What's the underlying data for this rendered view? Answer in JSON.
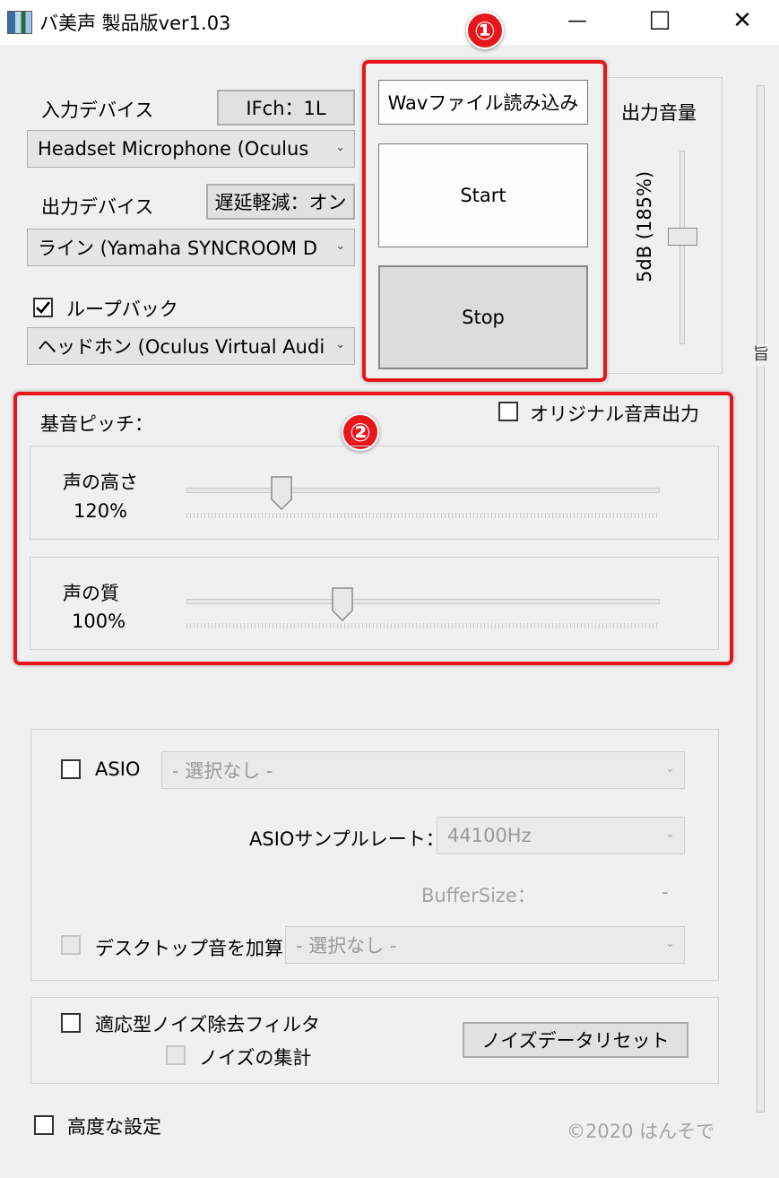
{
  "window": {
    "title": "バ美声 製品版ver1.03",
    "minimize": "—",
    "maximize": "☐",
    "close": "✕"
  },
  "io": {
    "input_label": "入力デバイス",
    "ifch_button": "IFch：1L",
    "input_device": "Headset Microphone (Oculus",
    "output_label": "出力デバイス",
    "latency_button": "遅延軽減：オン",
    "output_device": "ライン (Yamaha SYNCROOM D",
    "loopback_label": "ループバック",
    "loopback_checked": true,
    "loopback_device": "ヘッドホン (Oculus Virtual Audi"
  },
  "controls": {
    "badge": "①",
    "wav_button": "Wavファイル読み込み",
    "start_button": "Start",
    "stop_button": "Stop"
  },
  "output_volume": {
    "label": "出力音量",
    "value_text": "5dB (185%)",
    "level": 0.5
  },
  "pitch": {
    "badge": "②",
    "title": "基音ピッチ：",
    "original_output_label": "オリジナル音声出力",
    "height_label": "声の高さ",
    "height_value": "120%",
    "height_position": 0.2,
    "quality_label": "声の質",
    "quality_value": "100%",
    "quality_position": 0.33
  },
  "asio": {
    "asio_label": "ASIO",
    "asio_select": "- 選択なし -",
    "samplerate_label": "ASIOサンプルレート：",
    "samplerate_value": "44100Hz",
    "buffersize_label": "BufferSize：",
    "buffersize_value": "-",
    "desktop_label": "デスクトップ音を加算",
    "desktop_select": "- 選択なし -"
  },
  "noise": {
    "filter_label": "適応型ノイズ除去フィルタ",
    "aggregate_label": "ノイズの集計",
    "reset_button": "ノイズデータリセット"
  },
  "footer": {
    "advanced_label": "高度な設定",
    "copyright": "©2020 はんそで"
  },
  "scrollbar": {
    "glyph": "旨"
  },
  "colors": {
    "highlight_red": "#e8161b",
    "background": "#f0f0f0"
  }
}
